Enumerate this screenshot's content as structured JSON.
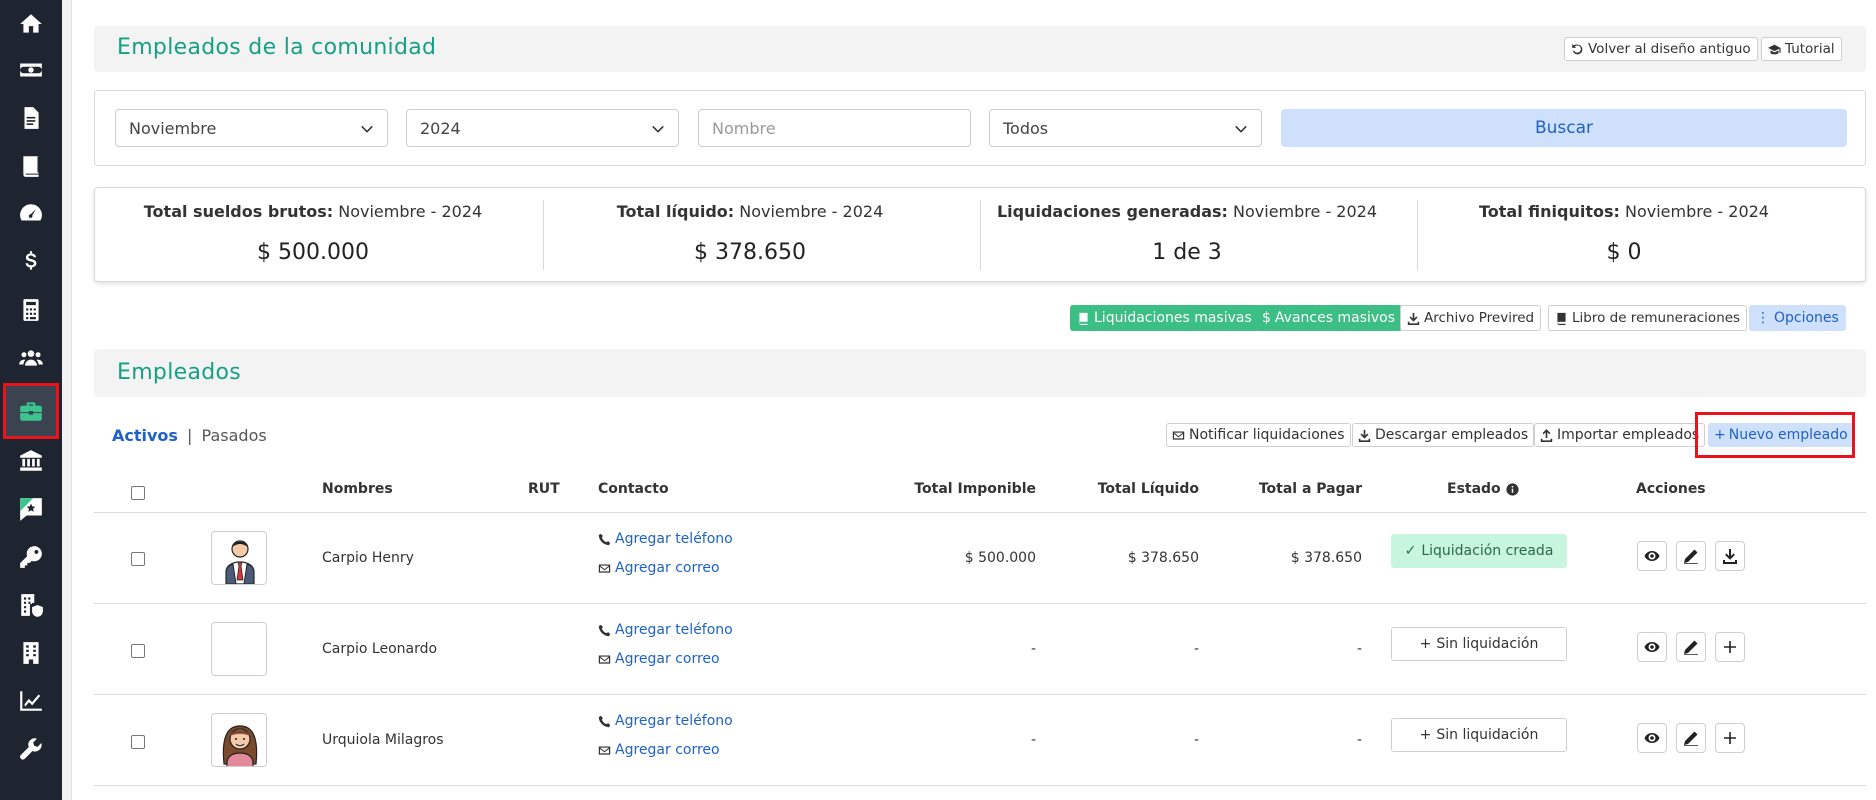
{
  "header": {
    "title": "Empleados de la comunidad",
    "back_label": "Volver al diseño antiguo",
    "tutorial_label": "Tutorial"
  },
  "filters": {
    "month": "Noviembre",
    "year": "2024",
    "name_placeholder": "Nombre",
    "status": "Todos",
    "search_label": "Buscar"
  },
  "summary": [
    {
      "label": "Total sueldos brutos:",
      "period": " Noviembre - 2024",
      "value": "$ 500.000"
    },
    {
      "label": "Total líquido:",
      "period": " Noviembre - 2024",
      "value": "$ 378.650"
    },
    {
      "label": "Liquidaciones generadas:",
      "period": " Noviembre - 2024",
      "value": "1 de 3"
    },
    {
      "label": "Total finiquitos:",
      "period": " Noviembre - 2024",
      "value": "$ 0"
    }
  ],
  "bulk": {
    "mass_liq": "Liquidaciones masivas",
    "mass_adv": "Avances masivos",
    "previred": "Archivo Previred",
    "book": "Libro de remuneraciones",
    "options": "Opciones"
  },
  "employees": {
    "title": "Empleados",
    "tab_active": "Activos",
    "tab_sep": "|",
    "tab_past": "Pasados",
    "notify": "Notificar liquidaciones",
    "download": "Descargar empleados",
    "import": "Importar empleados",
    "new": "Nuevo empleado"
  },
  "table": {
    "headers": {
      "name": "Nombres",
      "rut": "RUT",
      "contact": "Contacto",
      "taxable": "Total Imponible",
      "net": "Total Líquido",
      "pay": "Total a Pagar",
      "status": "Estado",
      "actions": "Acciones"
    },
    "add_phone": "Agregar teléfono",
    "add_email": "Agregar correo",
    "rows": [
      {
        "name": "Carpio Henry",
        "taxable": "$ 500.000",
        "net": "$ 378.650",
        "pay": "$ 378.650",
        "status": "Liquidación creada"
      },
      {
        "name": "Carpio Leonardo",
        "taxable": "-",
        "net": "-",
        "pay": "-",
        "status": "Sin liquidación"
      },
      {
        "name": "Urquiola Milagros",
        "taxable": "-",
        "net": "-",
        "pay": "-",
        "status": "Sin liquidación"
      }
    ]
  },
  "sidebar": {
    "icons": [
      "home-icon",
      "money-icon",
      "document-icon",
      "book-icon",
      "gauge-icon",
      "dollar-icon",
      "calculator-icon",
      "people-icon",
      "briefcase-icon",
      "bank-icon",
      "star-chat-icon",
      "key-icon",
      "building-shield-icon",
      "building-icon",
      "chart-line-icon",
      "wrench-icon"
    ]
  },
  "colors": {
    "accent": "#16a085",
    "link": "#1e62c9",
    "green": "#3cbf85",
    "highlight": "#e8141d"
  }
}
